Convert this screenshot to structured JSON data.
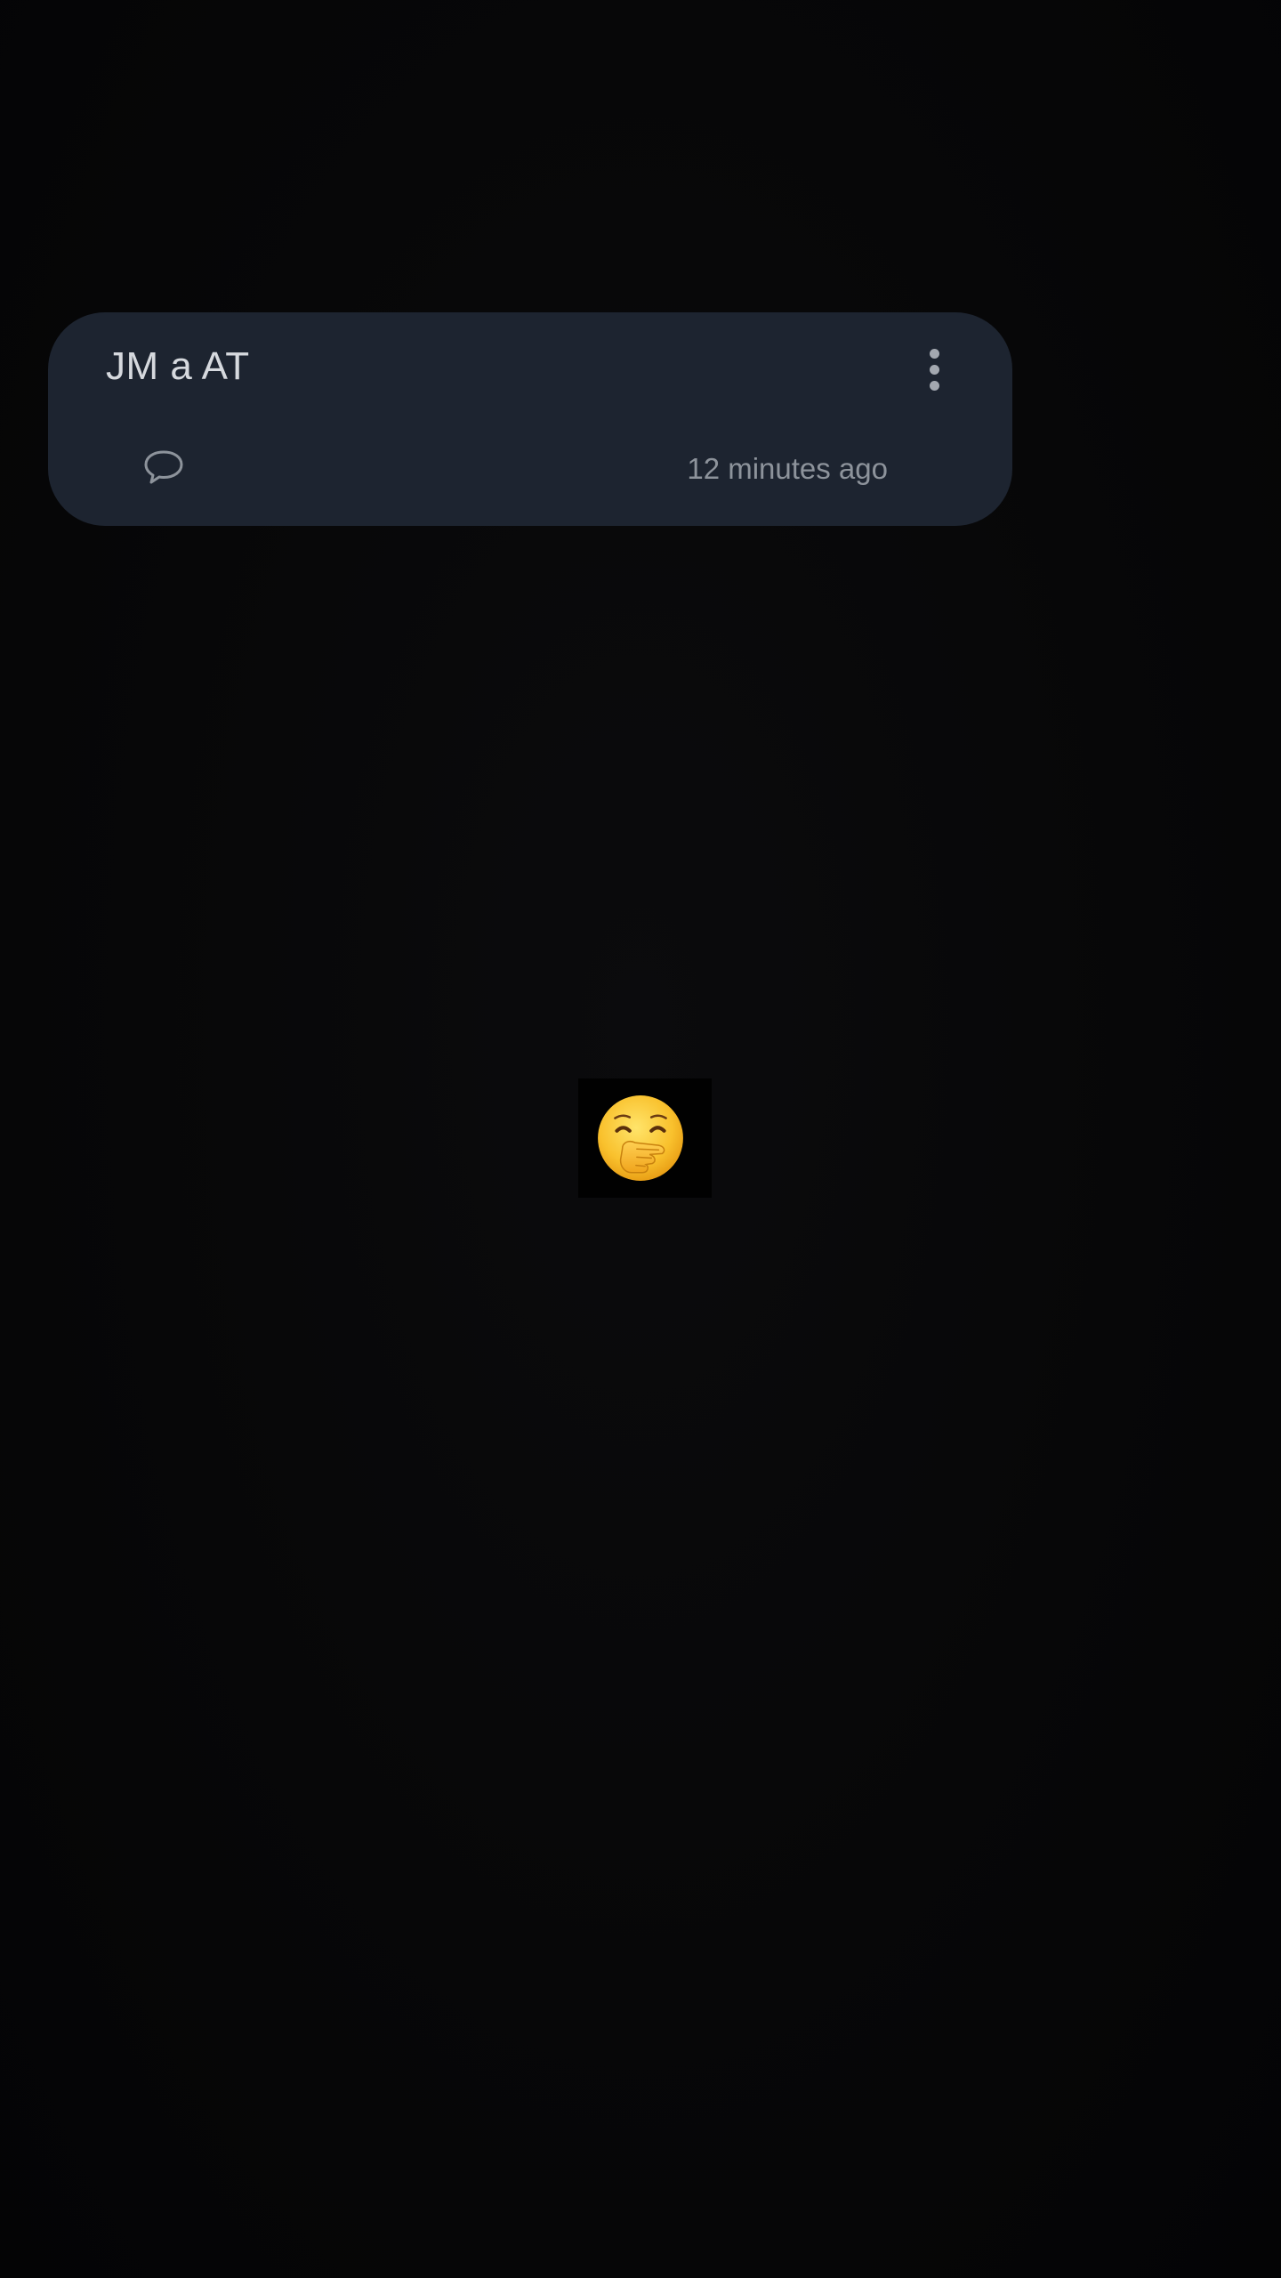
{
  "notification": {
    "title": "JM a AT",
    "timestamp": "12 minutes ago",
    "more_icon": "more-vert-icon",
    "comment_icon": "comment-bubble-icon"
  },
  "center_image": {
    "icon": "face-with-hand-over-mouth-emoji"
  },
  "colors": {
    "background": "#050506",
    "card": "#1d2430",
    "title_text": "#d6d9de",
    "meta_text": "#8d939b"
  }
}
